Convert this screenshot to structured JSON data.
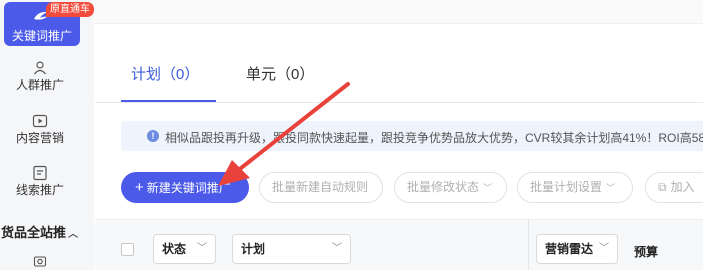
{
  "sidebar": {
    "active_item": {
      "label": "关键词推广",
      "badge": "原直通车"
    },
    "items": [
      {
        "label": "人群推广",
        "icon": "user-icon"
      },
      {
        "label": "内容营销",
        "icon": "play-icon"
      },
      {
        "label": "线索推广",
        "icon": "lead-form-icon"
      }
    ],
    "section": {
      "label": "货品全站推"
    }
  },
  "tabs": [
    {
      "label": "计划（0）",
      "active": true
    },
    {
      "label": "单元（0）",
      "active": false
    }
  ],
  "info_bar": {
    "text": "相似品跟投再升级，跟投同款快速起量，跟投竞争优势品放大优势，CVR较其余计划高41%！ROI高58"
  },
  "toolbar": {
    "primary_button": "新建关键词推广",
    "batch_rule_button": "批量新建自动规则",
    "batch_status_button": "批量修改状态",
    "batch_plan_button": "批量计划设置",
    "add_button": "加入"
  },
  "table_header": {
    "status_filter": "状态",
    "plan_filter": "计划",
    "radar_filter": "营销雷达",
    "budget_label": "预算"
  },
  "colors": {
    "primary": "#4b5ae8",
    "badge": "#f24b3c",
    "arrow": "#e8423a"
  }
}
